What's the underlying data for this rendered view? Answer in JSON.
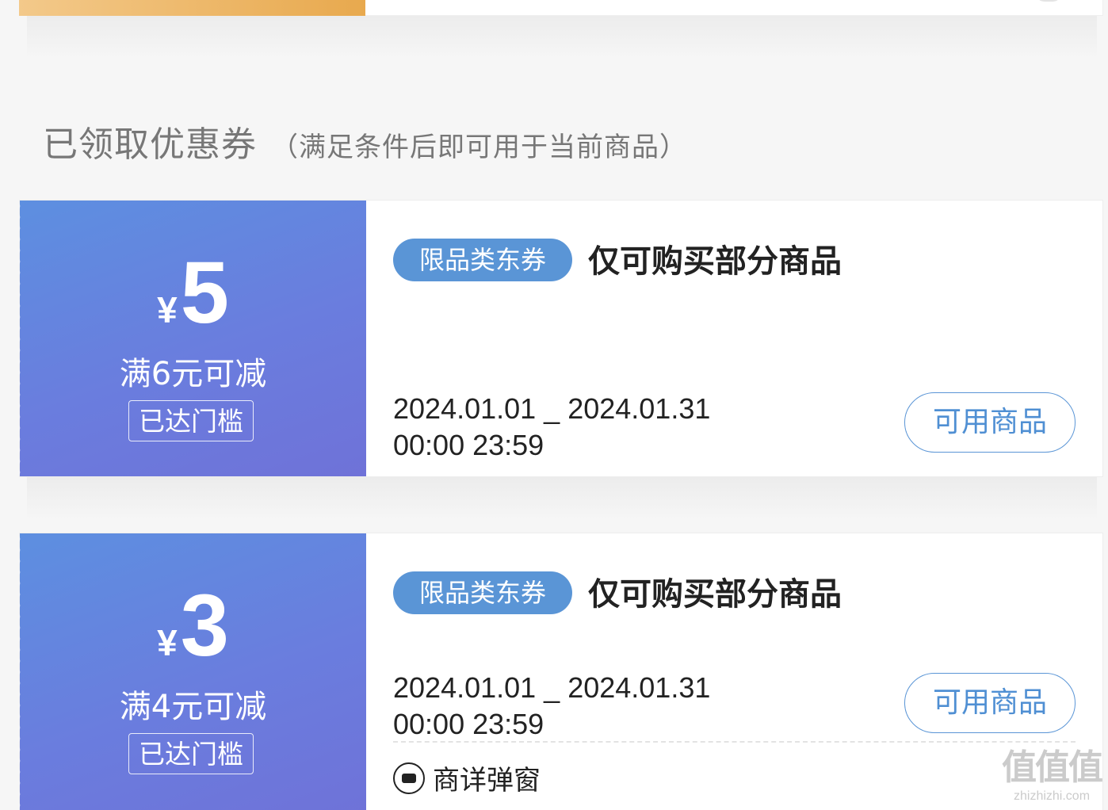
{
  "section": {
    "title": "已领取优惠券",
    "subtitle": "（满足条件后即可用于当前商品）"
  },
  "coupons": [
    {
      "currency": "¥",
      "amount": "5",
      "condition": "满6元可减",
      "threshold": "已达门槛",
      "tag": "限品类东券",
      "title": "仅可购买部分商品",
      "date_line1": "2024.01.01 _ 2024.01.31",
      "date_line2": "00:00 23:59",
      "button": "可用商品"
    },
    {
      "currency": "¥",
      "amount": "3",
      "condition": "满4元可减",
      "threshold": "已达门槛",
      "tag": "限品类东券",
      "title": "仅可购买部分商品",
      "date_line1": "2024.01.01 _ 2024.01.31",
      "date_line2": "00:00 23:59",
      "button": "可用商品",
      "popup_label": "商详弹窗"
    }
  ],
  "watermark": {
    "logo": "值值值",
    "url": "zhizhizhi.com"
  },
  "colors": {
    "accent": "#5a95d6",
    "coupon_gradient_start": "#5d8fe0",
    "coupon_gradient_end": "#6f72d8",
    "top_coupon": "#e8a94e"
  }
}
